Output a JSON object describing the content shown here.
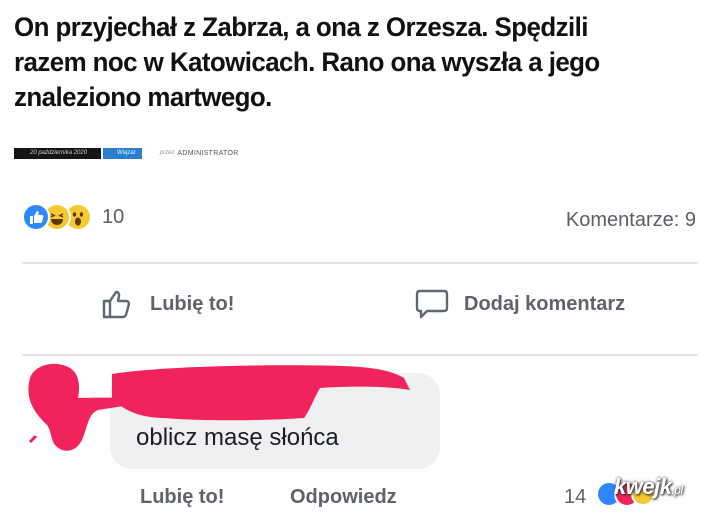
{
  "article": {
    "headline_lines": [
      "On przyjechał z Zabrza, a ona z Orzesza. Spędzili",
      "razem noc w Katowicach. Rano ona wyszła a jego",
      "znaleziono martwego."
    ],
    "meta": {
      "date": "20 października 2020",
      "category": "Wiązar",
      "by_prefix": "przez",
      "author": "ADMINISTRATOR"
    }
  },
  "post": {
    "reactions": [
      "like-icon",
      "haha-icon",
      "wow-icon"
    ],
    "reaction_count": "10",
    "comments_label": "Komentarze: 9",
    "actions": {
      "like_label": "Lubię to!",
      "comment_label": "Dodaj komentarz"
    }
  },
  "comment": {
    "text": "oblicz masę słońca",
    "like_label": "Lubię to!",
    "reply_label": "Odpowiedz",
    "reaction_count": "14"
  },
  "watermark": {
    "brand": "kwejk",
    "suffix": ".pl"
  },
  "colors": {
    "like_blue": "#2d88ff",
    "reaction_yellow": "#f7c930",
    "redaction_pink": "#f0245a",
    "category_blue": "#2b7fd0"
  }
}
